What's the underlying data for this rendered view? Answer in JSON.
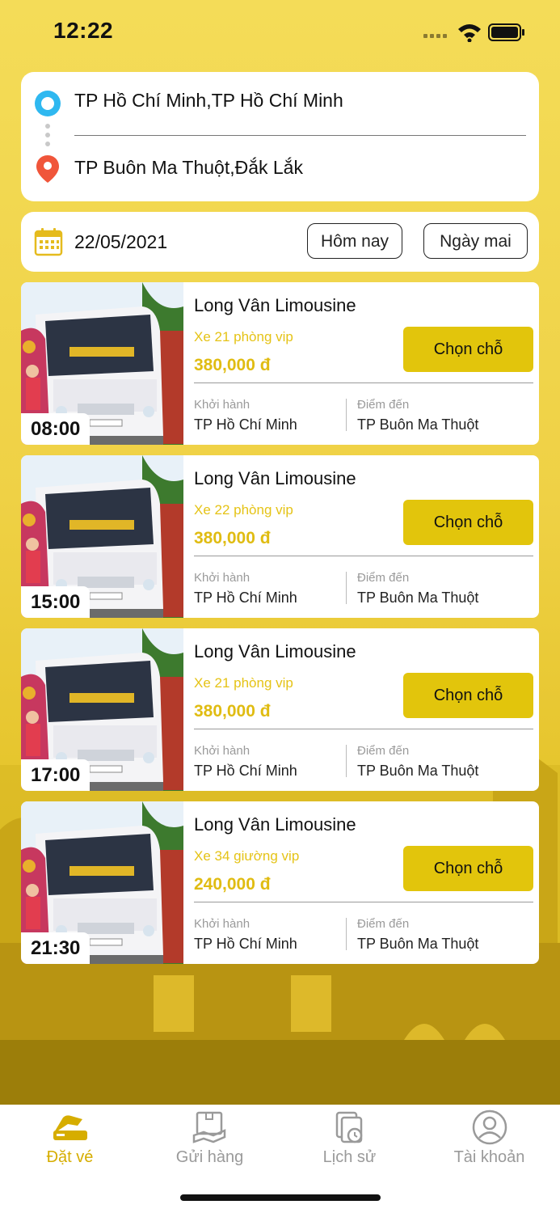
{
  "status_bar": {
    "time": "12:22"
  },
  "route": {
    "from": "TP Hồ Chí Minh,TP Hồ Chí Minh",
    "to": "TP Buôn Ma Thuột,Đắk Lắk"
  },
  "date_bar": {
    "date": "22/05/2021",
    "today_label": "Hôm nay",
    "tomorrow_label": "Ngày mai"
  },
  "trips": [
    {
      "time": "08:00",
      "operator": "Long Vân Limousine",
      "vehicle": "Xe 21 phòng vip",
      "price": "380,000 đ",
      "button": "Chọn chỗ",
      "depart_label": "Khởi hành",
      "depart": "TP Hồ Chí Minh",
      "arrive_label": "Điểm đến",
      "arrive": "TP Buôn Ma Thuột"
    },
    {
      "time": "15:00",
      "operator": "Long Vân Limousine",
      "vehicle": "Xe 22 phòng vip",
      "price": "380,000 đ",
      "button": "Chọn chỗ",
      "depart_label": "Khởi hành",
      "depart": "TP Hồ Chí Minh",
      "arrive_label": "Điểm đến",
      "arrive": "TP Buôn Ma Thuột"
    },
    {
      "time": "17:00",
      "operator": "Long Vân Limousine",
      "vehicle": "Xe 21 phòng vip",
      "price": "380,000 đ",
      "button": "Chọn chỗ",
      "depart_label": "Khởi hành",
      "depart": "TP Hồ Chí Minh",
      "arrive_label": "Điểm đến",
      "arrive": "TP Buôn Ma Thuột"
    },
    {
      "time": "21:30",
      "operator": "Long Vân Limousine",
      "vehicle": "Xe 34 giường vip",
      "price": "240,000 đ",
      "button": "Chọn chỗ",
      "depart_label": "Khởi hành",
      "depart": "TP Hồ Chí Minh",
      "arrive_label": "Điểm đến",
      "arrive": "TP Buôn Ma Thuột"
    }
  ],
  "tabbar": [
    {
      "label": "Đặt vé",
      "icon": "ticket-icon",
      "active": true
    },
    {
      "label": "Gửi hàng",
      "icon": "package-icon",
      "active": false
    },
    {
      "label": "Lịch sử",
      "icon": "history-icon",
      "active": false
    },
    {
      "label": "Tài khoản",
      "icon": "account-icon",
      "active": false
    }
  ],
  "colors": {
    "background": "#f3d64d",
    "accent": "#e2c50c",
    "price": "#e0bc12",
    "active_tab": "#d6ad00"
  }
}
